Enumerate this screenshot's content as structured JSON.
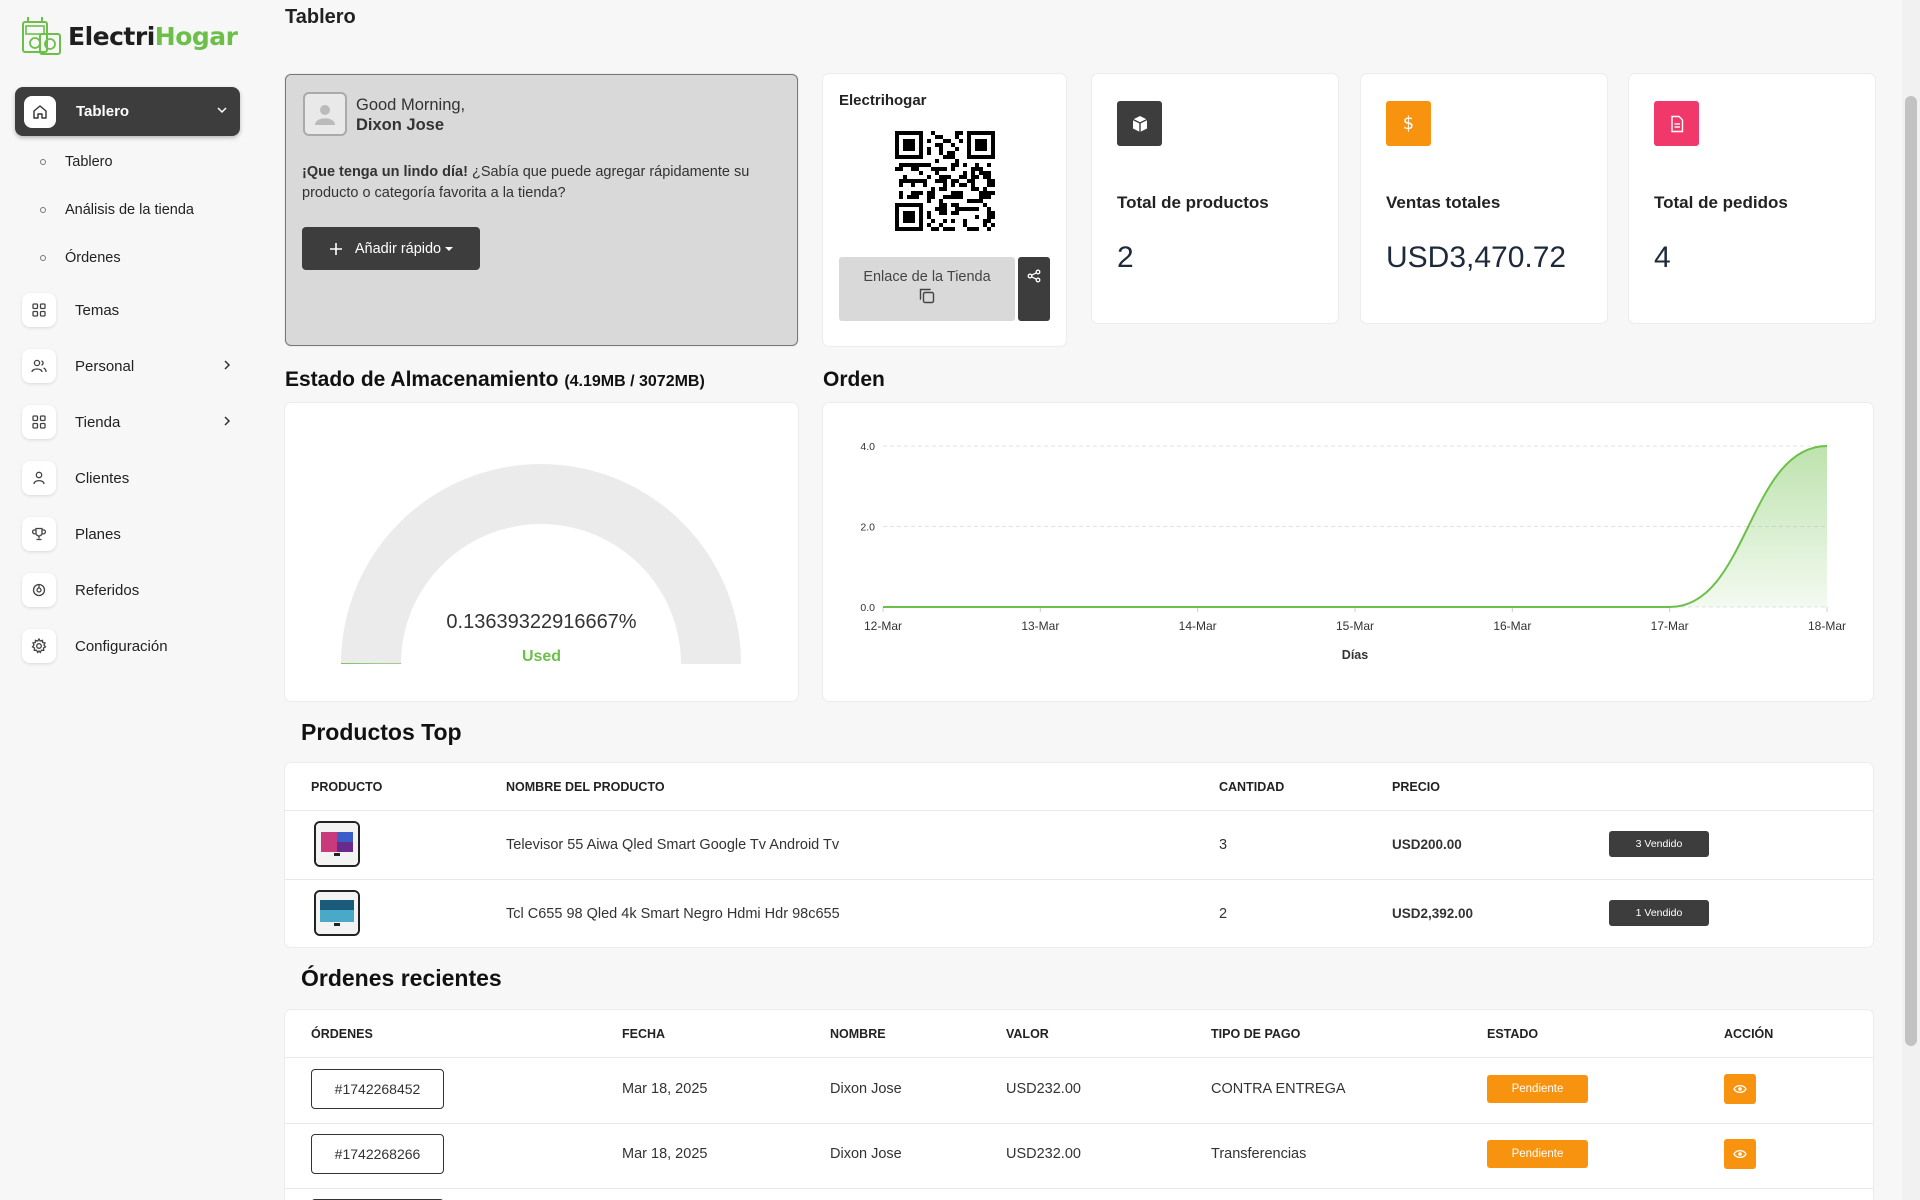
{
  "brand": {
    "part1": "Electri",
    "part2": "Hogar"
  },
  "sidebar": {
    "active": {
      "label": "Tablero"
    },
    "sub_items": [
      {
        "label": "Tablero"
      },
      {
        "label": "Análisis de la tienda"
      },
      {
        "label": "Órdenes"
      }
    ],
    "items": [
      {
        "label": "Temas",
        "icon": "grid-icon"
      },
      {
        "label": "Personal",
        "icon": "users-icon"
      },
      {
        "label": "Tienda",
        "icon": "grid-icon"
      },
      {
        "label": "Clientes",
        "icon": "user-icon"
      },
      {
        "label": "Planes",
        "icon": "trophy-icon"
      },
      {
        "label": "Referidos",
        "icon": "referral-icon"
      },
      {
        "label": "Configuración",
        "icon": "gear-icon"
      }
    ]
  },
  "header": {
    "title": "Tablero"
  },
  "welcome": {
    "greeting": "Good Morning,",
    "name": "Dixon Jose",
    "msg_bold": "¡Que tenga un lindo día!",
    "msg_rest": " ¿Sabía que puede agregar rápidamente su producto o categoría favorita a la tienda?",
    "quick_add_label": "Añadir rápido"
  },
  "qr": {
    "title": "Electrihogar",
    "store_link_label": "Enlace de la Tienda"
  },
  "stats": [
    {
      "label": "Total de productos",
      "value": "2",
      "color": "#3d3d3d",
      "icon": "box-icon"
    },
    {
      "label": "Ventas totales",
      "value": "USD3,470.72",
      "color": "#f7930f",
      "icon": "dollar-icon"
    },
    {
      "label": "Total de pedidos",
      "value": "4",
      "color": "#f0386b",
      "icon": "document-icon"
    }
  ],
  "storage": {
    "title": "Estado de Almacenamiento",
    "usage": "(4.19MB / 3072MB)",
    "percent_text": "0.13639322916667%",
    "used_label": "Used",
    "used_fraction": 0.0013639322916667
  },
  "orders_chart": {
    "title": "Orden"
  },
  "chart_data": {
    "type": "area",
    "categories": [
      "12-Mar",
      "13-Mar",
      "14-Mar",
      "15-Mar",
      "16-Mar",
      "17-Mar",
      "18-Mar"
    ],
    "values": [
      0,
      0,
      0,
      0,
      0,
      0,
      4
    ],
    "y_ticks": [
      "0.0",
      "2.0",
      "4.0"
    ],
    "ylim": [
      0,
      4
    ],
    "xlabel": "Días",
    "ylabel": "",
    "color": "#6cc04a",
    "grid": true
  },
  "top_products": {
    "title": "Productos Top",
    "headers": [
      "PRODUCTO",
      "NOMBRE DEL PRODUCTO",
      "CANTIDAD",
      "PRECIO"
    ],
    "rows": [
      {
        "name": "Televisor 55 Aiwa Qled Smart Google Tv Android Tv",
        "qty": "3",
        "price": "USD200.00",
        "sold": "3 Vendido"
      },
      {
        "name": "Tcl C655 98 Qled 4k Smart Negro Hdmi Hdr 98c655",
        "qty": "2",
        "price": "USD2,392.00",
        "sold": "1 Vendido"
      }
    ]
  },
  "recent_orders": {
    "title": "Órdenes recientes",
    "headers": [
      "ÓRDENES",
      "FECHA",
      "NOMBRE",
      "VALOR",
      "TIPO DE PAGO",
      "ESTADO",
      "ACCIÓN"
    ],
    "rows": [
      {
        "id": "#1742268452",
        "date": "Mar 18, 2025",
        "name": "Dixon Jose",
        "value": "USD232.00",
        "payment": "CONTRA ENTREGA",
        "status": "Pendiente"
      },
      {
        "id": "#1742268266",
        "date": "Mar 18, 2025",
        "name": "Dixon Jose",
        "value": "USD232.00",
        "payment": "Transferencias",
        "status": "Pendiente"
      }
    ]
  }
}
